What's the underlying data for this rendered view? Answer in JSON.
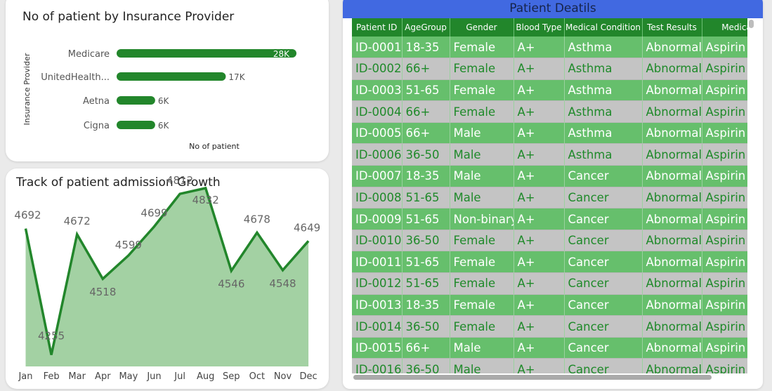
{
  "bar_card": {
    "title": "No of patient by Insurance Provider"
  },
  "line_card": {
    "title": "Track of patient admission Growth"
  },
  "table_card": {
    "title": "Patient Deatils",
    "columns": [
      "Patient ID",
      "AgeGroup",
      "Gender",
      "Blood Type",
      "Medical Condition",
      "Test Results",
      "Medication"
    ],
    "rows": [
      [
        "ID-0001",
        "18-35",
        "Female",
        "A+",
        "Asthma",
        "Abnormal",
        "Aspirin"
      ],
      [
        "ID-0002",
        "66+",
        "Female",
        "A+",
        "Asthma",
        "Abnormal",
        "Aspirin"
      ],
      [
        "ID-0003",
        "51-65",
        "Female",
        "A+",
        "Asthma",
        "Abnormal",
        "Aspirin"
      ],
      [
        "ID-0004",
        "66+",
        "Female",
        "A+",
        "Asthma",
        "Abnormal",
        "Aspirin"
      ],
      [
        "ID-0005",
        "66+",
        "Male",
        "A+",
        "Asthma",
        "Abnormal",
        "Aspirin"
      ],
      [
        "ID-0006",
        "36-50",
        "Male",
        "A+",
        "Asthma",
        "Abnormal",
        "Aspirin"
      ],
      [
        "ID-0007",
        "18-35",
        "Male",
        "A+",
        "Cancer",
        "Abnormal",
        "Aspirin"
      ],
      [
        "ID-0008",
        "51-65",
        "Male",
        "A+",
        "Cancer",
        "Abnormal",
        "Aspirin"
      ],
      [
        "ID-0009",
        "51-65",
        "Non-binary",
        "A+",
        "Cancer",
        "Abnormal",
        "Aspirin"
      ],
      [
        "ID-0010",
        "36-50",
        "Female",
        "A+",
        "Cancer",
        "Abnormal",
        "Aspirin"
      ],
      [
        "ID-0011",
        "51-65",
        "Female",
        "A+",
        "Cancer",
        "Abnormal",
        "Aspirin"
      ],
      [
        "ID-0012",
        "51-65",
        "Female",
        "A+",
        "Cancer",
        "Abnormal",
        "Aspirin"
      ],
      [
        "ID-0013",
        "18-35",
        "Female",
        "A+",
        "Cancer",
        "Abnormal",
        "Aspirin"
      ],
      [
        "ID-0014",
        "36-50",
        "Female",
        "A+",
        "Cancer",
        "Abnormal",
        "Aspirin"
      ],
      [
        "ID-0015",
        "66+",
        "Male",
        "A+",
        "Cancer",
        "Abnormal",
        "Aspirin"
      ],
      [
        "ID-0016",
        "36-50",
        "Male",
        "A+",
        "Cancer",
        "Abnormal",
        "Aspirin"
      ]
    ]
  },
  "colors": {
    "bar": "#22862b",
    "line": "#22862b",
    "area": "#a3d1a3",
    "header_blue": "#4169e1",
    "row_green": "#66bf6c",
    "row_gray": "#c4c4c4"
  },
  "chart_data": [
    {
      "type": "bar",
      "orientation": "horizontal",
      "title": "No of patient by Insurance Provider",
      "xlabel": "No of patient",
      "ylabel": "Insurance Provider",
      "categories": [
        "Medicare",
        "UnitedHealth...",
        "Aetna",
        "Cigna"
      ],
      "values": [
        28000,
        17000,
        6000,
        6000
      ],
      "data_labels": [
        "28K",
        "17K",
        "6K",
        "6K"
      ],
      "xlim": [
        0,
        28000
      ]
    },
    {
      "type": "area",
      "title": "Track of patient admission Growth",
      "categories": [
        "Jan",
        "Feb",
        "Mar",
        "Apr",
        "May",
        "Jun",
        "Jul",
        "Aug",
        "Sep",
        "Oct",
        "Nov",
        "Dec"
      ],
      "values": [
        4692,
        4255,
        4672,
        4518,
        4599,
        4699,
        4812,
        4832,
        4546,
        4678,
        4548,
        4649
      ],
      "ylim": [
        4210,
        4900
      ]
    }
  ]
}
